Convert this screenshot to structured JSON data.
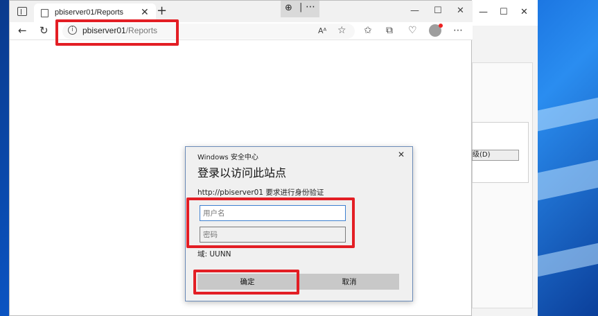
{
  "browser": {
    "tab_title": "pbiserver01/Reports",
    "new_tab_glyph": "+",
    "zoom_glyph": "⊕",
    "url_host": "pbiserver01",
    "url_path": "/Reports",
    "icons": [
      "tab-actions-icon",
      "page-icon",
      "close-icon",
      "plus-icon",
      "zoom-in-icon",
      "more-icon",
      "minimize-icon",
      "maximize-icon",
      "back-icon",
      "refresh-icon",
      "info-icon",
      "read-aloud-icon",
      "favorite-icon",
      "favorites-icon",
      "collections-icon",
      "browser-essentials-icon",
      "profile-icon"
    ]
  },
  "background_window": {
    "select_text": "级(D)"
  },
  "dialog": {
    "window_title": "Windows 安全中心",
    "heading": "登录以访问此站点",
    "message": "http://pbiserver01 要求进行身份验证",
    "username_placeholder": "用户名",
    "password_placeholder": "密码",
    "domain_text": "域: UUNN",
    "ok_label": "确定",
    "cancel_label": "取消"
  },
  "colors": {
    "highlight": "#e31e24",
    "dialog_border": "#6a8bb8",
    "input_focus": "#3c7fd0"
  }
}
